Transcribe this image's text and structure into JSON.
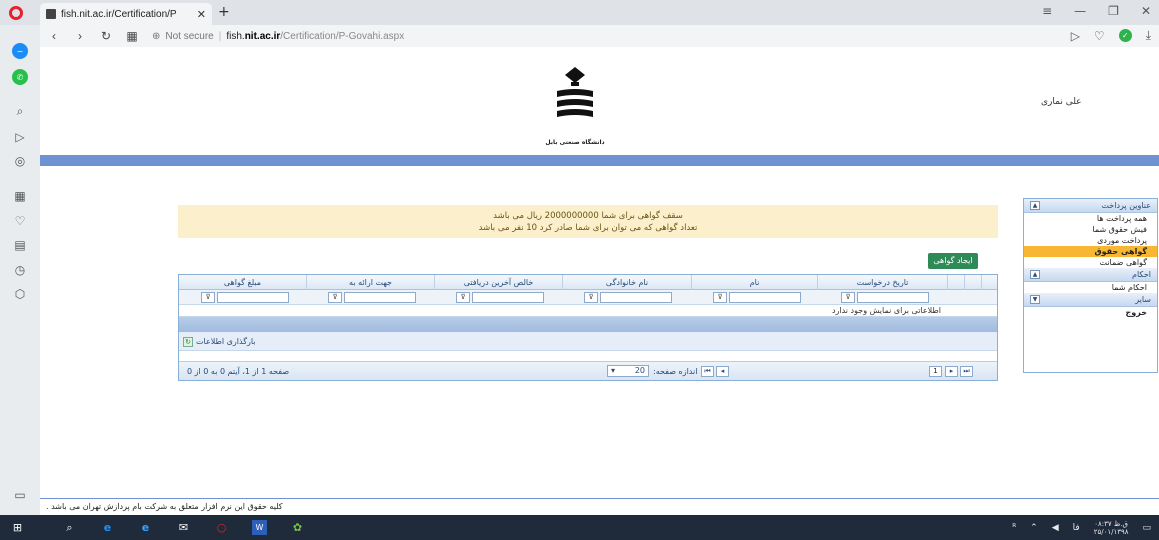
{
  "browser": {
    "tab_title": "fish.nit.ac.ir/Certification/P",
    "tab_close": "✕",
    "new_tab": "+",
    "security_label": "Not secure",
    "url_host": "fish.",
    "url_domain": "nit.ac.ir",
    "url_path": "/Certification/P-Govahi.aspx"
  },
  "page": {
    "logo_caption": "دانشگاه صنعتی بابل",
    "username": "علی نماری",
    "notice_line1": "سقف گواهی برای شما 2000000000 ریال می باشد",
    "notice_line2": "تعداد گواهی که می توان برای شما صادر کرد 10 نفر می باشد",
    "create_button": "ایجاد گواهی",
    "footer_text": "کلیه حقوق این نرم افزار متعلق به شرکت بام پردازش تهران می باشد ."
  },
  "grid": {
    "columns": [
      "مبلغ گواهی",
      "جهت ارائه به",
      "خالص آخرین دریافتی",
      "نام خانوادگی",
      "نام",
      "تاریخ درخواست"
    ],
    "no_data_text": "اطلاعاتی برای نمایش وجود ندارد",
    "refresh_label": "بارگذاری اطلاعات",
    "pager_status": "صفحه 1 از 1، آیتم 0 به 0 از 0",
    "page_size_label": "اندازه صفحه:",
    "page_size_value": "20",
    "current_page": "1"
  },
  "menu": {
    "sections": [
      {
        "title": "عناوین پرداخت",
        "toggle": "▲",
        "items": [
          "همه پرداخت ها",
          "فیش حقوق شما",
          "پرداخت موردی",
          "گواهی حقوق",
          "گواهی ضمانت"
        ]
      },
      {
        "title": "احکام",
        "toggle": "▲",
        "items": [
          "احکام شما"
        ]
      },
      {
        "title": "سایر",
        "toggle": "▼",
        "items": [
          "خروج"
        ]
      }
    ],
    "active_item": "گواهی حقوق"
  },
  "taskbar": {
    "lang": "فا",
    "time": "۰۸:۳۷ ق.ظ",
    "date": "۲۵/۰۱/۱۳۹۸"
  },
  "colors": {
    "accent_band": "#6f93d2",
    "notice_bg": "#fcefcc",
    "create_button": "#2e8b57",
    "active_menu": "#f7b733"
  }
}
